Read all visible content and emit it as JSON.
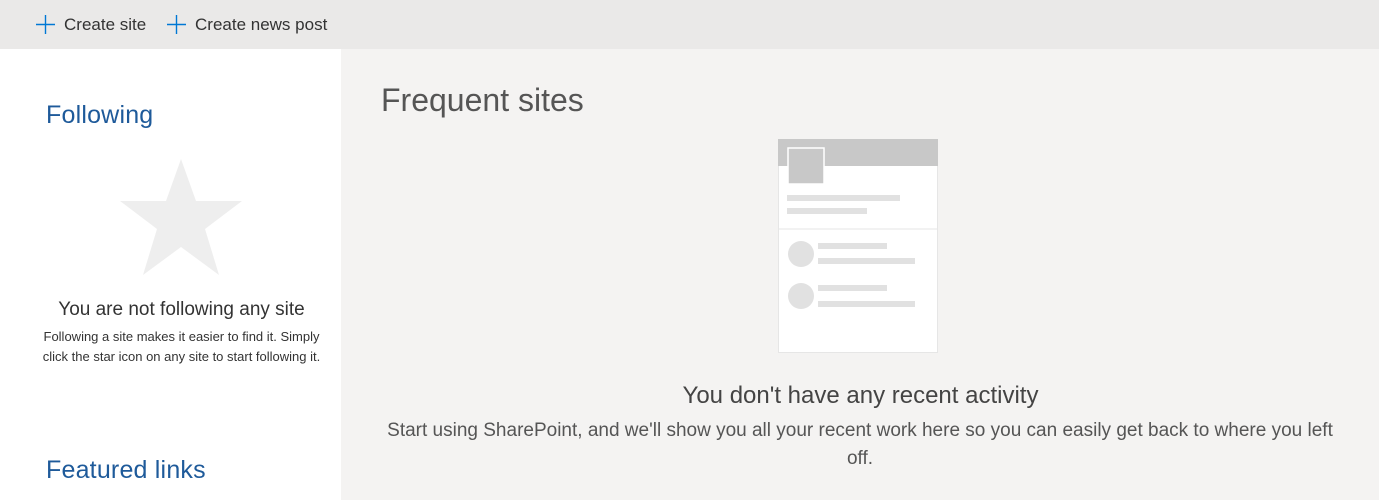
{
  "commandbar": {
    "create_site_label": "Create site",
    "create_news_post_label": "Create news post"
  },
  "following": {
    "title": "Following",
    "empty_heading": "You are not following any site",
    "empty_body": "Following a site makes it easier to find it. Simply click the star icon on any site to start following it."
  },
  "featured_links": {
    "title": "Featured links"
  },
  "frequent_sites": {
    "title": "Frequent sites",
    "empty_heading": "You don't have any recent activity",
    "empty_body": "Start using SharePoint, and we'll show you all your recent work here so you can easily get back to where you left off."
  },
  "icons": {
    "plus": "plus-icon",
    "star": "star-icon",
    "placeholder": "site-card-placeholder-icon"
  },
  "colors": {
    "accent": "#0078d4",
    "section_title": "#1e5a9a",
    "illustration_gray": "#c8c8c8"
  }
}
